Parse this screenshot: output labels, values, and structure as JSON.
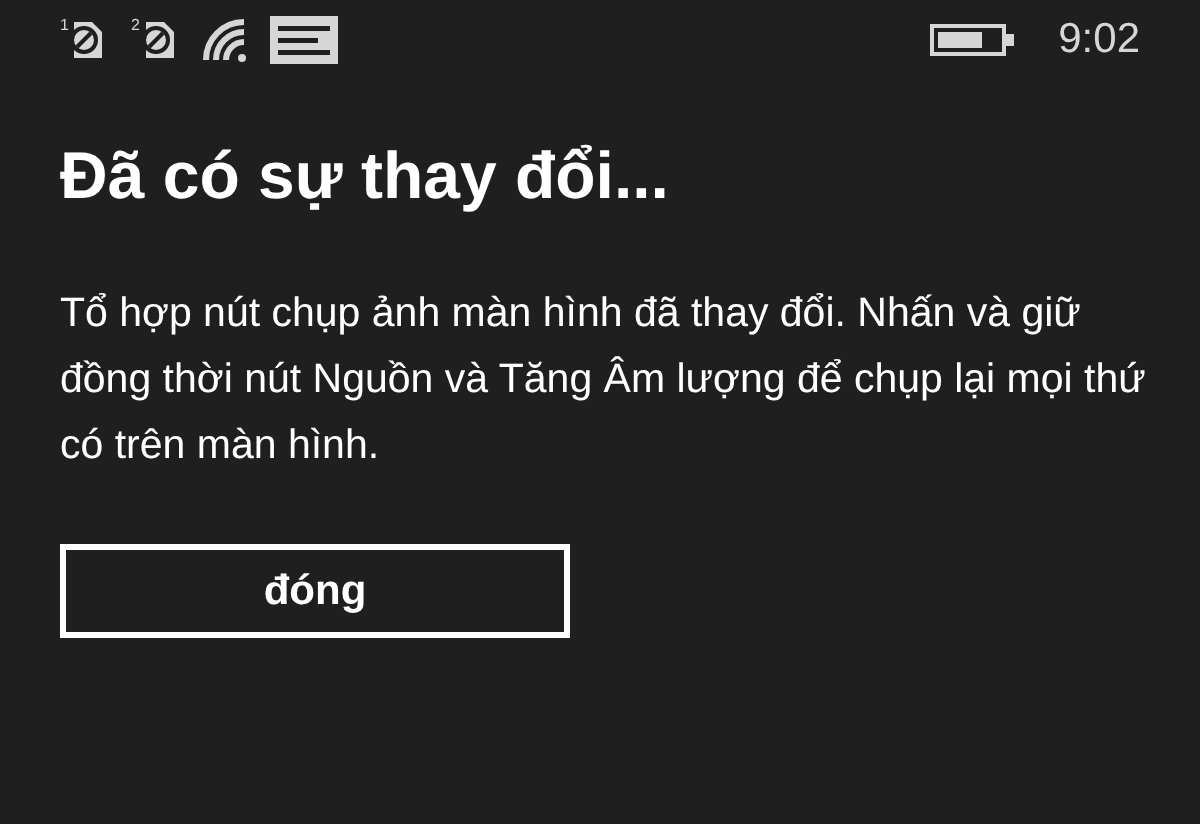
{
  "status_bar": {
    "sims": [
      {
        "label": "1"
      },
      {
        "label": "2"
      }
    ],
    "time": "9:02"
  },
  "dialog": {
    "title": "Đã có sự thay đổi...",
    "message": "Tổ hợp nút chụp ảnh màn hình đã thay đổi. Nhấn và giữ đồng thời nút Nguồn và Tăng Âm lượng để chụp lại mọi thứ có trên màn hình.",
    "buttons": [
      "đóng"
    ]
  }
}
